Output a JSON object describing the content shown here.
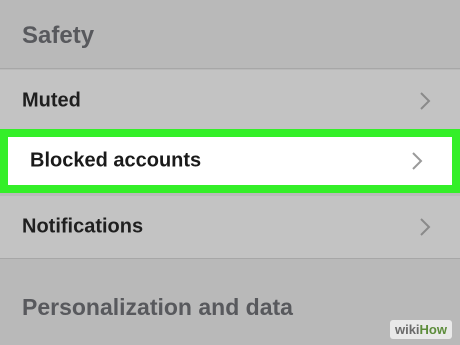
{
  "sections": {
    "safety_title": "Safety",
    "personalization_title": "Personalization and data"
  },
  "rows": {
    "muted": "Muted",
    "blocked": "Blocked accounts",
    "notifications": "Notifications"
  },
  "highlight_color": "#34ef28",
  "watermark": {
    "brand": "wiki",
    "suffix": "How"
  }
}
